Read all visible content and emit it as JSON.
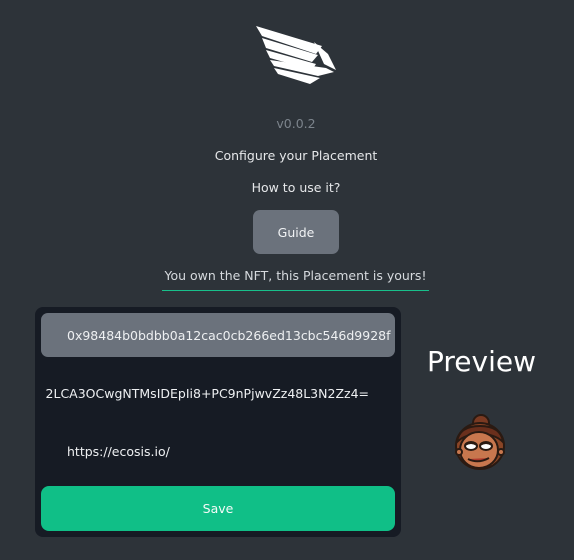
{
  "header": {
    "logo_icon": "wing-logo-icon",
    "version": "v0.0.2",
    "configure_text": "Configure your Placement",
    "howto_text": "How to use it?",
    "guide_label": "Guide"
  },
  "status": {
    "owned_text": "You own the NFT, this Placement is yours!",
    "accent": "#18c08b"
  },
  "form": {
    "address_value": "0x98484b0bdbb0a12cac0cb266ed13cbc546d9928f",
    "key_value": "2LCA3OCwgNTMsIDEpIi8+PC9nPjwvZz48L3N2Zz4=",
    "url_value": "https://ecosis.io/",
    "save_label": "Save",
    "save_color": "#10bf87"
  },
  "preview": {
    "title": "Preview",
    "avatar_icon": "avatar-icon"
  }
}
